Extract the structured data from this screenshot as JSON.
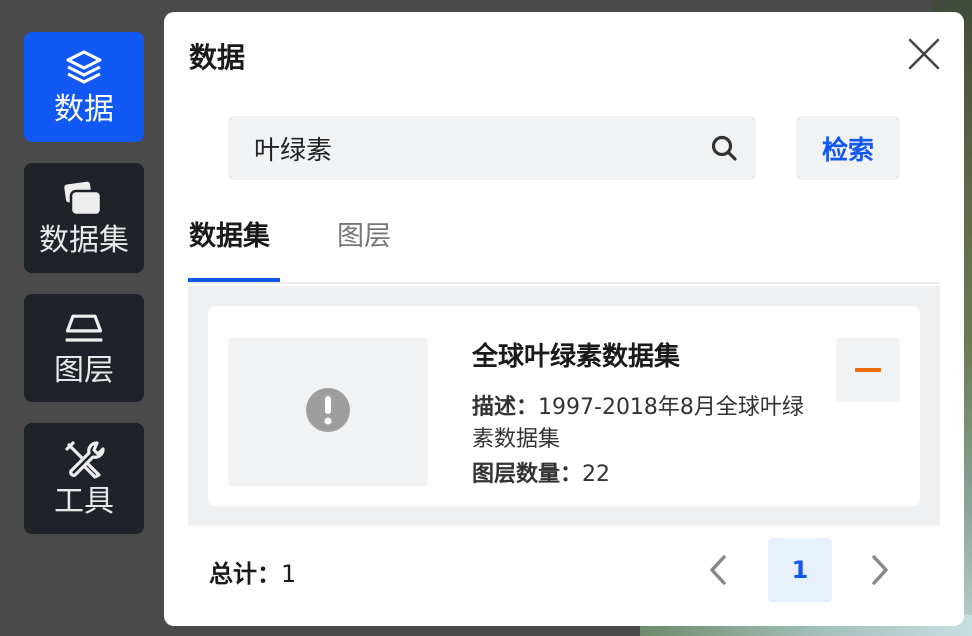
{
  "sidebar": {
    "items": [
      {
        "label": "数据",
        "icon": "layers-icon",
        "active": true
      },
      {
        "label": "数据集",
        "icon": "folder-stack-icon",
        "active": false
      },
      {
        "label": "图层",
        "icon": "layer-trapezoid-icon",
        "active": false
      },
      {
        "label": "工具",
        "icon": "tools-icon",
        "active": false
      }
    ]
  },
  "panel": {
    "title": "数据",
    "close_icon": "close-icon"
  },
  "search": {
    "value": "叶绿素",
    "placeholder": "",
    "button_label": "检索"
  },
  "tabs": [
    {
      "label": "数据集",
      "active": true
    },
    {
      "label": "图层",
      "active": false
    }
  ],
  "results": [
    {
      "title": "全球叶绿素数据集",
      "desc_key": "描述：",
      "desc_value": "1997-2018年8月全球叶绿素数据集",
      "count_key": "图层数量：",
      "count_value": "22",
      "thumbnail_icon": "warning-icon",
      "action_icon": "minus-icon"
    }
  ],
  "footer": {
    "total_key": "总计：",
    "total_value": "1",
    "current_page": "1"
  },
  "colors": {
    "accent": "#1258f5",
    "sidebar_bg": "#1f2229",
    "remove_accent": "#f06a10"
  }
}
